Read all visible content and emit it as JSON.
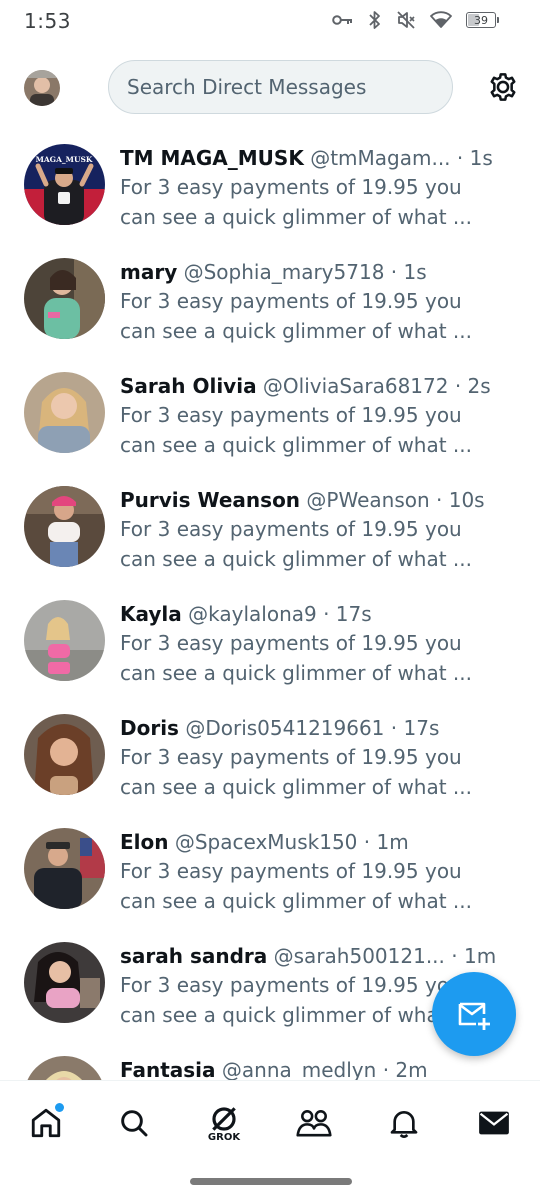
{
  "status": {
    "time": "1:53",
    "battery": "39",
    "battery_level": 0.39
  },
  "header": {
    "search_placeholder": "Search Direct Messages",
    "avatar_icon": "profile-avatar",
    "settings_icon": "gear-icon"
  },
  "conversations": [
    {
      "name": "TM MAGA_MUSK",
      "handle": "@tmMagam...",
      "time": "· 1s",
      "line1": "For 3 easy payments of 19.95 you",
      "line2": "can see a quick glimmer of what ...",
      "avatar_text": "MAGA_MUSK"
    },
    {
      "name": "mary",
      "handle": "@Sophia_mary5718",
      "time": "· 1s",
      "line1": "For 3 easy payments of 19.95 you",
      "line2": "can see a quick glimmer of what ..."
    },
    {
      "name": "Sarah Olivia",
      "handle": "@OliviaSara68172",
      "time": "· 2s",
      "line1": "For 3 easy payments of 19.95 you",
      "line2": "can see a quick glimmer of what ..."
    },
    {
      "name": "Purvis Weanson",
      "handle": "@PWeanson",
      "time": "· 10s",
      "line1": "For 3 easy payments of 19.95 you",
      "line2": "can see a quick glimmer of what ..."
    },
    {
      "name": "Kayla",
      "handle": "@kaylalona9",
      "time": "· 17s",
      "line1": "For 3 easy payments of 19.95 you",
      "line2": "can see a quick glimmer of what ..."
    },
    {
      "name": "Doris",
      "handle": "@Doris0541219661",
      "time": "· 17s",
      "line1": "For 3 easy payments of 19.95 you",
      "line2": "can see a quick glimmer of what ..."
    },
    {
      "name": "Elon",
      "handle": "@SpacexMusk150",
      "time": "· 1m",
      "line1": "For 3 easy payments of 19.95 you",
      "line2": "can see a quick glimmer of what ..."
    },
    {
      "name": "sarah sandra",
      "handle": "@sarah500121...",
      "time": "· 1m",
      "line1": "For 3 easy payments of 19.95 you",
      "line2": "can see a quick glimmer of what ..."
    },
    {
      "name": "Fantasia",
      "handle": "@anna_medlyn",
      "time": "· 2m",
      "line1": "",
      "line2": ""
    }
  ],
  "nav": {
    "grok_label": "GROK",
    "items": [
      "home-icon",
      "search-icon",
      "grok-icon",
      "communities-icon",
      "notifications-icon",
      "messages-icon"
    ]
  },
  "fab_icon": "new-message-icon",
  "colors": {
    "accent": "#1d9bf0",
    "text_primary": "#0f1419",
    "text_secondary": "#536471"
  }
}
